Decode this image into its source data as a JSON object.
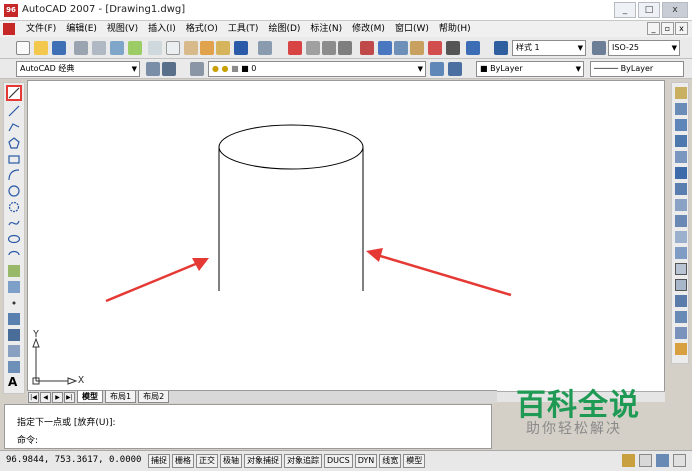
{
  "window": {
    "title": "AutoCAD 2007 - [Drawing1.dwg]",
    "app_icon_text": "96",
    "minimize": "_",
    "maximize": "□",
    "close": "x",
    "doc_minimize": "_",
    "doc_restore": "▫",
    "doc_close": "x"
  },
  "menu": [
    {
      "label": "文件(F)"
    },
    {
      "label": "编辑(E)"
    },
    {
      "label": "视图(V)"
    },
    {
      "label": "插入(I)"
    },
    {
      "label": "格式(O)"
    },
    {
      "label": "工具(T)"
    },
    {
      "label": "绘图(D)"
    },
    {
      "label": "标注(N)"
    },
    {
      "label": "修改(M)"
    },
    {
      "label": "窗口(W)"
    },
    {
      "label": "帮助(H)"
    }
  ],
  "toolbar": {
    "text_style": "样式 1",
    "dim_style": "ISO-25",
    "workspace": "AutoCAD 经典",
    "layer": "0",
    "color": "ByLayer",
    "linetype": "ByLayer"
  },
  "canvas": {
    "ucs_y": "Y",
    "ucs_x": "X"
  },
  "tabs": [
    {
      "label": "模型",
      "active": true
    },
    {
      "label": "布局1",
      "active": false
    },
    {
      "label": "布局2",
      "active": false
    }
  ],
  "command": {
    "line1": "指定下一点或 [放弃(U)]:",
    "line2": "命令:"
  },
  "watermark": {
    "title": "百科全说",
    "subtitle": "助你轻松解决"
  },
  "status": {
    "coords": "96.9844, 753.3617, 0.0000",
    "toggles": [
      "捕捉",
      "栅格",
      "正交",
      "极轴",
      "对象捕捉",
      "对象追踪",
      "DUCS",
      "DYN",
      "线宽",
      "模型"
    ]
  },
  "colors": {
    "accent_red": "#e53935",
    "watermark_green": "#1f9a54"
  }
}
